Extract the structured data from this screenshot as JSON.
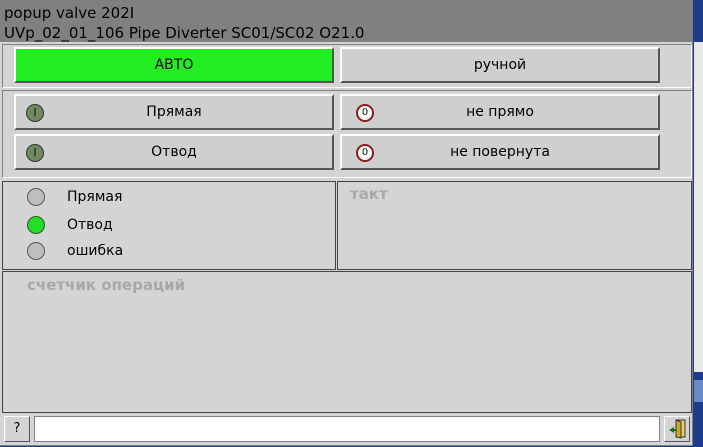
{
  "window": {
    "title_line1": "popup valve 202I",
    "title_line2": "UVp_02_01_106 Pipe Diverter SC01/SC02 O21.0"
  },
  "mode": {
    "auto_label": "АВТО",
    "manual_label": "ручной",
    "active": "auto"
  },
  "commands": {
    "straight_label": "Прямая",
    "diverted_label": "Отвод",
    "not_straight_label": "не прямо",
    "not_turned_label": "не повернута",
    "on_symbol": "I",
    "off_symbol": "0"
  },
  "status": {
    "items": [
      {
        "label": "Прямая",
        "state": "off"
      },
      {
        "label": "Отвод",
        "state": "on"
      },
      {
        "label": "ошибка",
        "state": "off"
      }
    ]
  },
  "takt": {
    "label": "такт"
  },
  "counter": {
    "label": "счетчик операций"
  },
  "footer": {
    "help_label": "?"
  },
  "colors": {
    "active_green": "#22ee22",
    "lamp_on": "#22dd22",
    "lamp_off": "#bdbdbd",
    "title_bg": "#808080"
  }
}
